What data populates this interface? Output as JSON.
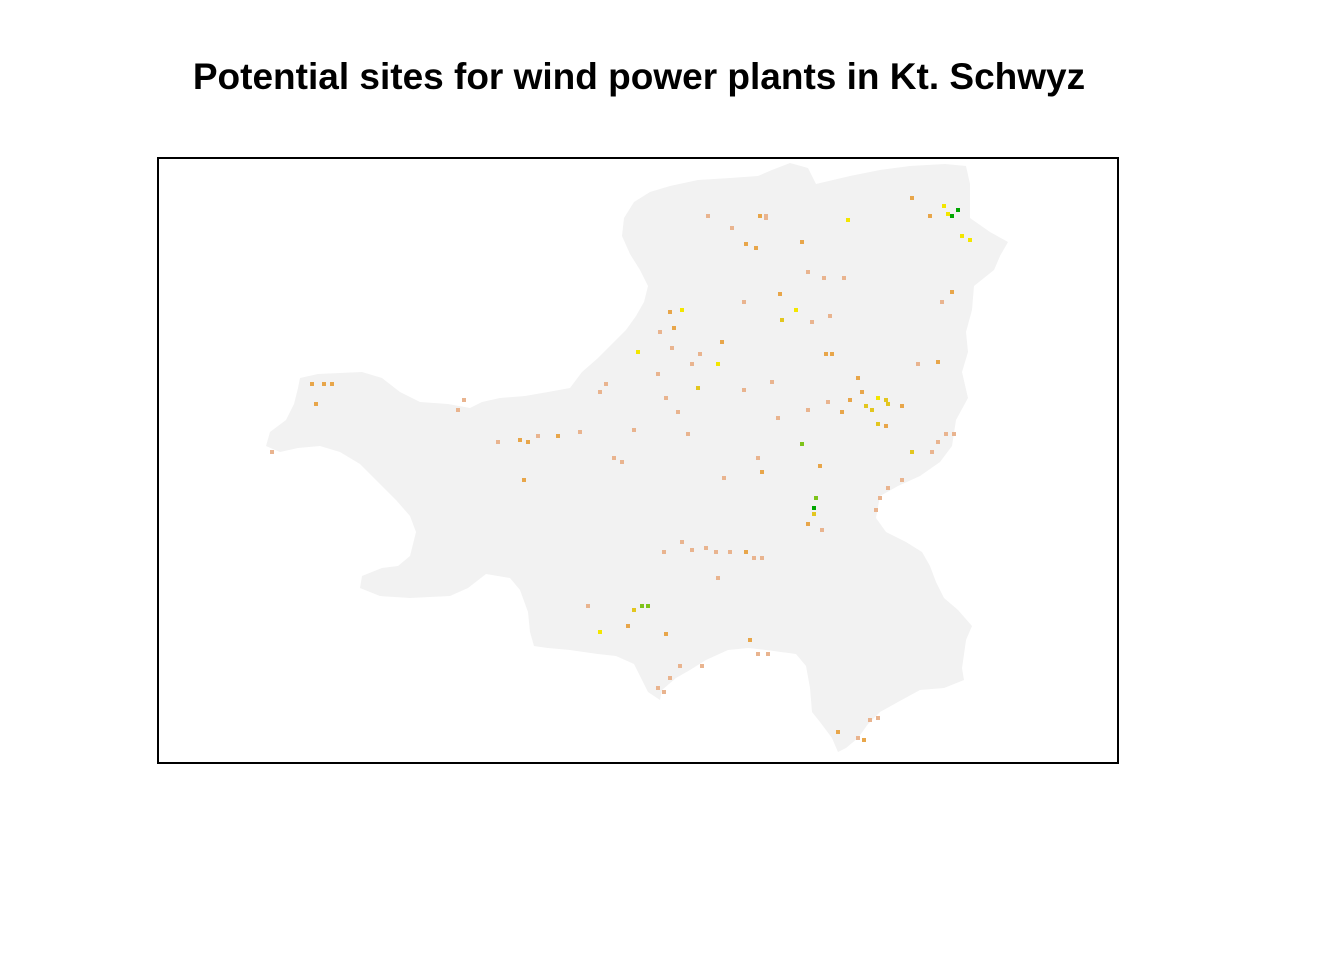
{
  "title": "Potential sites for wind power plants in Kt. Schwyz",
  "map": {
    "region": "Kt. Schwyz",
    "background_color": "#f2f2f2",
    "suitability_colors": {
      "low": "#f1d6cc",
      "medium_low": "#e9b48f",
      "medium": "#e8a64a",
      "medium_high": "#e3c61f",
      "high": "#f3e600",
      "higher": "#7ec31a",
      "highest": "#00a600"
    },
    "axes": "none",
    "legend": "none"
  }
}
